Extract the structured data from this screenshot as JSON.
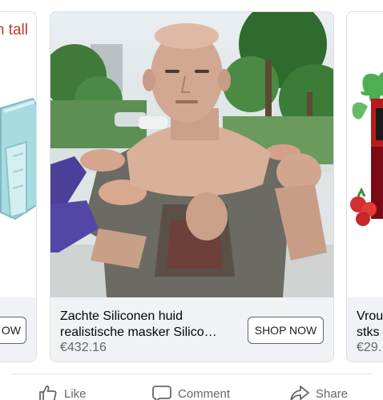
{
  "carousel": {
    "left_card": {
      "title_fragment": "n tall",
      "button_fragment": "OW"
    },
    "main_card": {
      "title": "Zachte Siliconen huid realistische masker Silico…",
      "price": "€432.16",
      "button_label": "SHOP NOW"
    },
    "right_card": {
      "title_fragment": "Vrou",
      "title_fragment_2": "stks",
      "price_fragment": "€29."
    }
  },
  "actions": {
    "like": "Like",
    "comment": "Comment",
    "share": "Share"
  },
  "colors": {
    "left_title": "#c0392b",
    "text_secondary": "#65676b",
    "card_bg": "#f0f2f5",
    "border": "#dddfe2"
  },
  "icons": {
    "like": "thumbs-up-icon",
    "comment": "comment-bubble-icon",
    "share": "share-arrow-icon"
  }
}
